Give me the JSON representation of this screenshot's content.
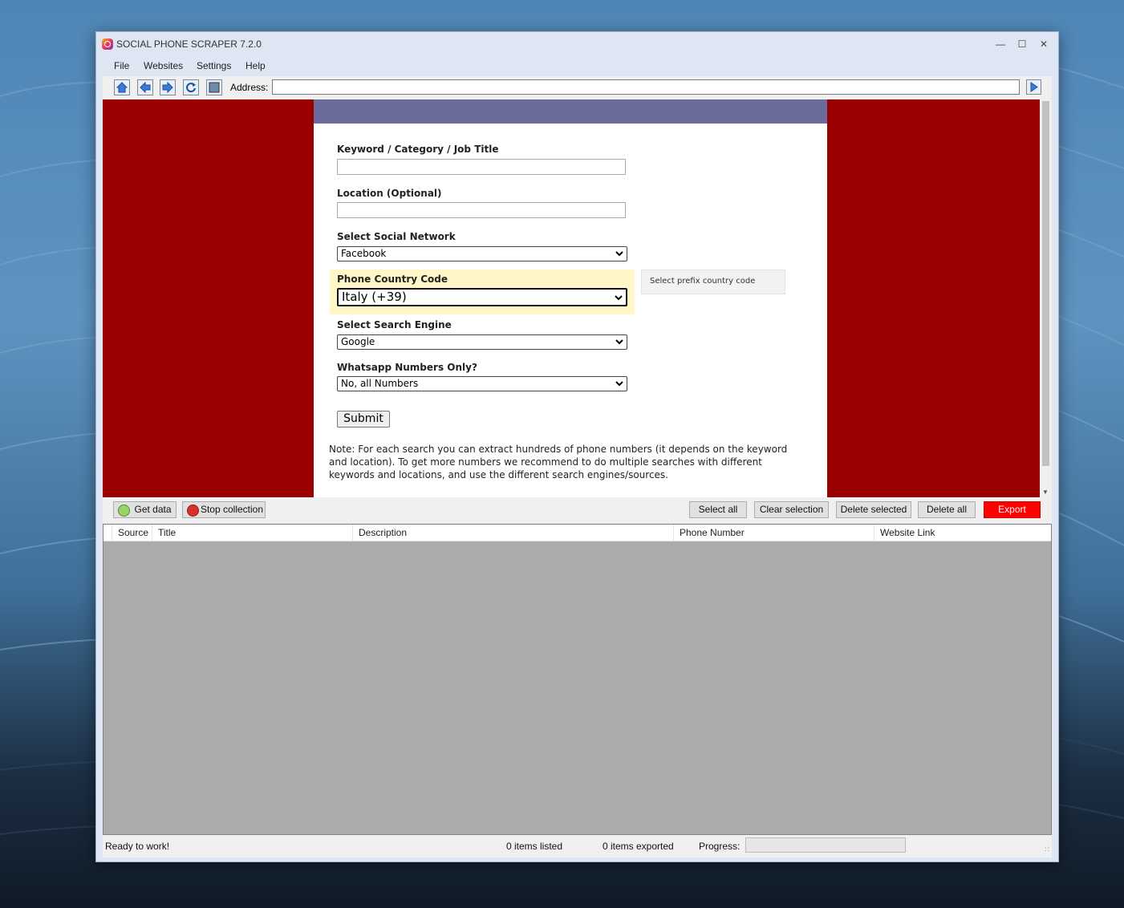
{
  "window": {
    "title": "SOCIAL PHONE SCRAPER 7.2.0"
  },
  "menu": [
    "File",
    "Websites",
    "Settings",
    "Help"
  ],
  "toolbar": {
    "address_label": "Address:",
    "address_value": ""
  },
  "form": {
    "keyword_label": "Keyword / Category / Job Title",
    "keyword_value": "",
    "location_label": "Location (Optional)",
    "location_value": "",
    "network_label": "Select Social Network",
    "network_value": "Facebook",
    "country_label": "Phone Country Code",
    "country_value": "Italy (+39)",
    "country_tip": "Select prefix country code",
    "engine_label": "Select Search Engine",
    "engine_value": "Google",
    "whatsapp_label": "Whatsapp Numbers Only?",
    "whatsapp_value": "No, all Numbers",
    "submit_label": "Submit",
    "note": "Note: For each search you can extract hundreds of phone numbers (it depends on the keyword and location). To get more numbers we recommend to do multiple searches with different keywords and locations, and use the different search engines/sources."
  },
  "actions": {
    "get_data": "Get data",
    "stop": "Stop collection",
    "select_all": "Select all",
    "clear_selection": "Clear selection",
    "delete_selected": "Delete selected",
    "delete_all": "Delete all",
    "export": "Export"
  },
  "table": {
    "columns": [
      "Source",
      "Title",
      "Description",
      "Phone Number",
      "Website Link"
    ],
    "rows": []
  },
  "status": {
    "message": "Ready to work!",
    "listed": "0 items listed",
    "exported": "0 items exported",
    "progress_label": "Progress:",
    "progress": 0
  },
  "colors": {
    "browser_bg": "#990000",
    "panel_header": "#6b6b9c",
    "highlight": "#fff7c6",
    "export": "#ff0000"
  }
}
